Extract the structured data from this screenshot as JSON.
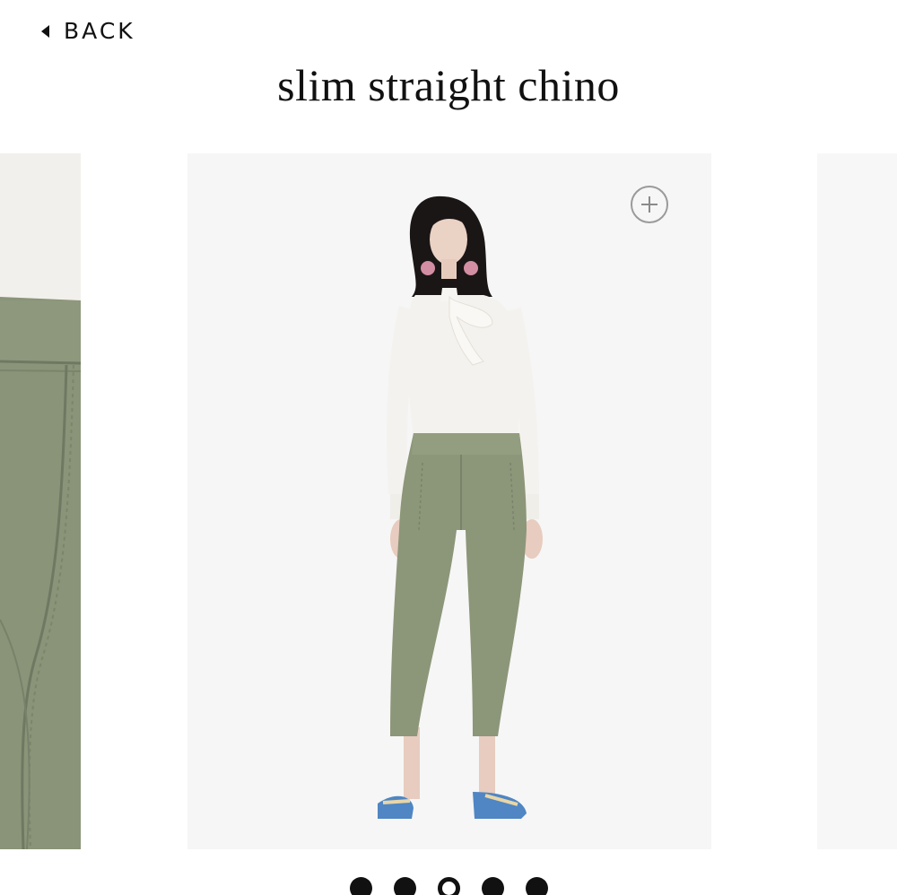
{
  "header": {
    "back_label": "BACK",
    "back_icon": "triangle-left-icon",
    "title": "slim straight chino"
  },
  "carousel": {
    "zoom_icon": "plus-circle-icon",
    "slides": [
      {
        "name": "detail-closeup",
        "colors": {
          "top": "#f1efeb",
          "pants": "#8a9478"
        }
      },
      {
        "name": "model-front-view",
        "colors": {
          "blouse": "#f4f2ee",
          "pants": "#8c9679",
          "hair": "#1b1616",
          "sandals": "#4f86c3"
        }
      },
      {
        "name": "next-view",
        "colors": {
          "background": "#f7f7f7"
        }
      }
    ],
    "pagination": {
      "count": 5,
      "active_index": 2
    }
  },
  "colors": {
    "text": "#111111",
    "image_bg": "#f6f6f6"
  }
}
